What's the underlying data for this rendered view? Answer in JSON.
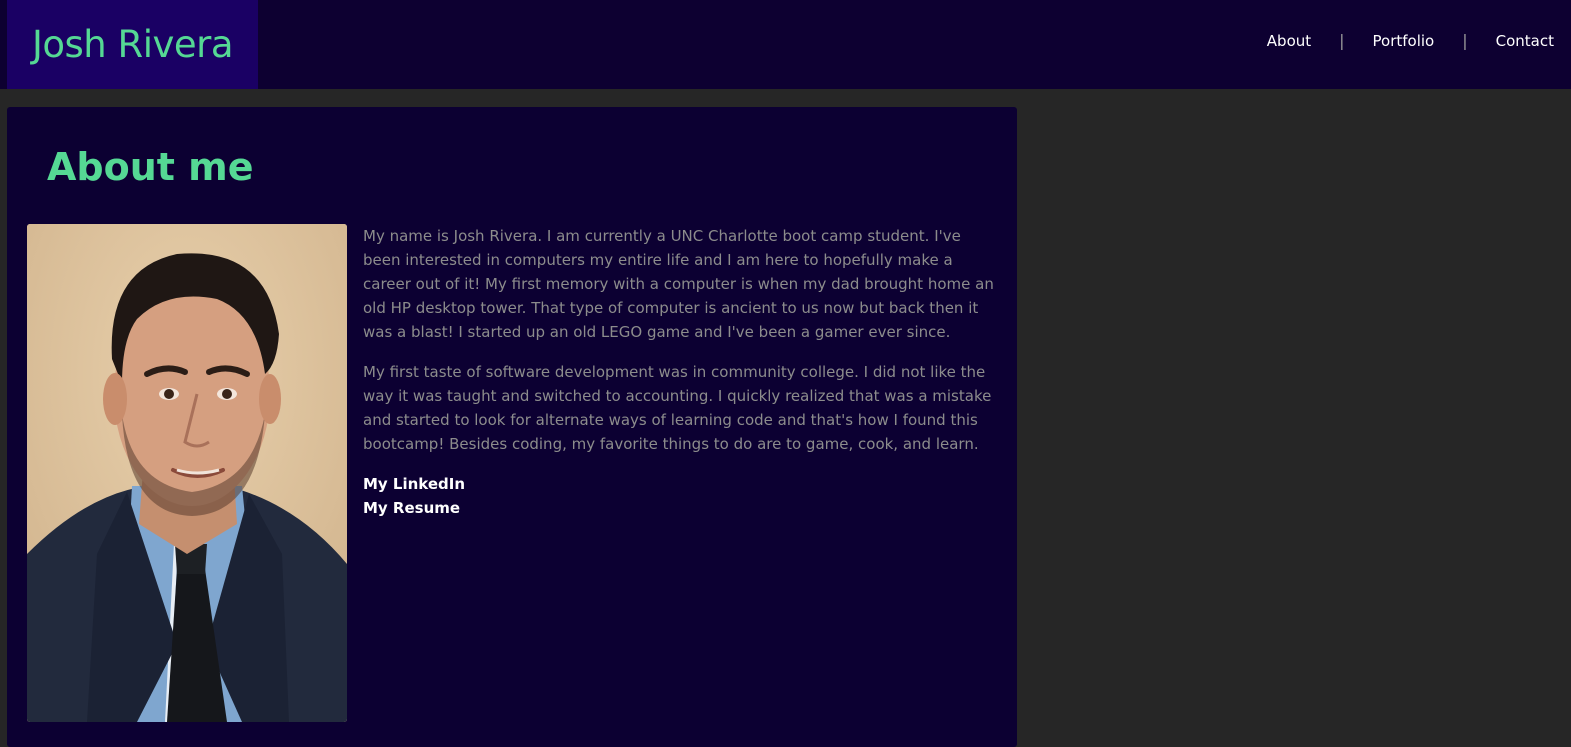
{
  "header": {
    "brand": "Josh Rivera",
    "nav": [
      {
        "label": "About"
      },
      {
        "label": "Portfolio"
      },
      {
        "label": "Contact"
      }
    ],
    "separator": "|"
  },
  "about": {
    "title": "About me",
    "paragraphs": [
      "My name is Josh Rivera. I am currently a UNC Charlotte boot camp student. I've been interested in computers my entire life and I am here to hopefully make a career out of it! My first memory with a computer is when my dad brought home an old HP desktop tower. That type of computer is ancient to us now but back then it was a blast! I started up an old LEGO game and I've been a gamer ever since.",
      "My first taste of software development was in community college. I did not like the way it was taught and switched to accounting. I quickly realized that was a mistake and started to look for alternate ways of learning code and that's how I found this bootcamp! Besides coding, my favorite things to do are to game, cook, and learn."
    ],
    "links": [
      {
        "label": "My LinkedIn"
      },
      {
        "label": "My Resume"
      }
    ]
  },
  "colors": {
    "accent": "#55d894",
    "header_bg": "#0d0031",
    "brand_bg": "#1a0064",
    "card_bg": "#0c0032",
    "page_bg": "#262626",
    "body_text": "#8c8c8c"
  }
}
